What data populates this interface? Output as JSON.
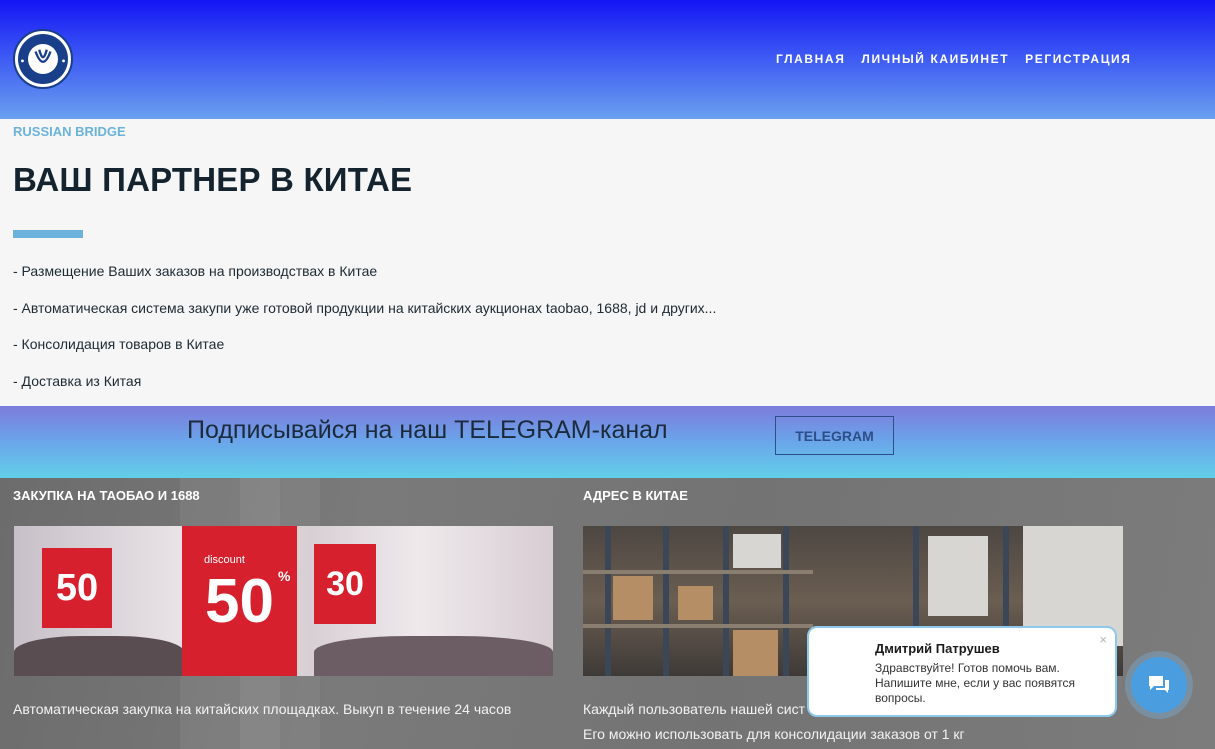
{
  "header": {
    "logo_text": "RUSSIAN BRIDGE",
    "nav": [
      {
        "label": "ГЛАВНАЯ"
      },
      {
        "label": "ЛИЧНЫЙ КАИБИНЕТ"
      },
      {
        "label": "РЕГИСТРАЦИЯ"
      }
    ]
  },
  "hero": {
    "eyebrow": "RUSSIAN BRIDGE",
    "title": "ВАШ ПАРТНЕР В КИТАЕ",
    "features": [
      "- Размещение Ваших заказов на производствах в Китае",
      "- Автоматическая система закупи уже готовой продукции на китайских аукционах taobao, 1688, jd и других...",
      "- Консолидация товаров в Китае",
      "- Доставка из Китая"
    ]
  },
  "telegram": {
    "text": "Подписывайся на наш TELEGRAM-канал",
    "button_label": "TELEGRAM"
  },
  "services": {
    "left": {
      "title": "ЗАКУПКА НА ТАОБАО И 1688",
      "image_labels": {
        "sign1": "50",
        "sign2": "50",
        "sign2_small": "discount",
        "sign2_pct": "%",
        "sign3": "30"
      },
      "text": "Автоматическая закупка на китайских площадках. Выкуп в течение 24 часов"
    },
    "right": {
      "title": "АДРЕС В КИТАЕ",
      "text1": "Каждый пользователь нашей сист",
      "text2": "Его можно использовать для консолидации заказов от 1 кг"
    }
  },
  "chat": {
    "name": "Дмитрий Патрушев",
    "message": "Здравствуйте! Готов помочь вам. Напишите мне, если у вас появятся вопросы.",
    "close": "×"
  },
  "colors": {
    "accent": "#6bb3dc",
    "header_top": "#1515f5",
    "chat_button": "#4a9ee0"
  }
}
